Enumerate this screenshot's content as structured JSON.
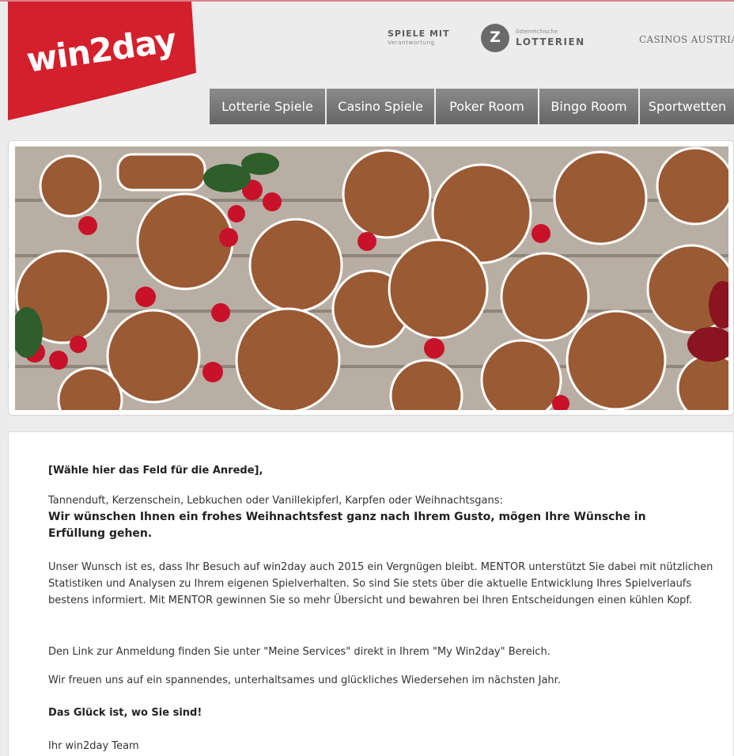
{
  "logo": {
    "text": "win2day",
    "color": "#d41f2c"
  },
  "sponsors": {
    "lotto_title": "SPIELE MIT",
    "lotto_subtitle": "Verantwortung",
    "lotto_icon_text": "Z",
    "lotto_name_small": "österreichische",
    "lotto_name": "LOTTERIEN",
    "casinos": "CASINOS AUSTRIA"
  },
  "nav": {
    "tabs": [
      {
        "label": "Lotterie Spiele"
      },
      {
        "label": "Casino Spiele"
      },
      {
        "label": "Poker Room"
      },
      {
        "label": "Bingo Room"
      },
      {
        "label": "Sportwetten"
      }
    ]
  },
  "banner": {
    "subject": "gingerbread-cookies-and-berries"
  },
  "message": {
    "salutation": "[Wähle hier das Feld für die Anrede],",
    "intro": "Tannenduft, Kerzenschein, Lebkuchen oder Vanillekipferl, Karpfen oder Weihnachtsgans:",
    "wish": "Wir wünschen Ihnen ein frohes Weihnachtsfest ganz nach Ihrem Gusto, mögen Ihre Wünsche in Erfüllung gehen.",
    "paragraph_mentor": "Unser Wunsch ist es, dass Ihr Besuch auf win2day auch 2015 ein Vergnügen bleibt. MENTOR unterstützt Sie dabei mit nützlichen Statistiken und Analysen zu Ihrem eigenen Spielverhalten. So sind Sie stets über die aktuelle Entwicklung Ihres Spielverlaufs bestens informiert. Mit MENTOR gewinnen Sie so mehr Übersicht und bewahren bei Ihren Entscheidungen einen kühlen Kopf.",
    "paragraph_link": "Den Link zur Anmeldung finden Sie unter \"Meine Services\" direkt in Ihrem \"My Win2day\" Bereich.",
    "paragraph_wish": "Wir freuen uns auf ein spannendes, unterhaltsames und glückliches Wiedersehen im nächsten Jahr.",
    "slogan": "Das Glück ist, wo Sie sind!",
    "signature": "Ihr win2day Team"
  },
  "colors": {
    "nav_tab": "#777777",
    "logo_red": "#d41f2c",
    "page_bg": "#ececec"
  }
}
